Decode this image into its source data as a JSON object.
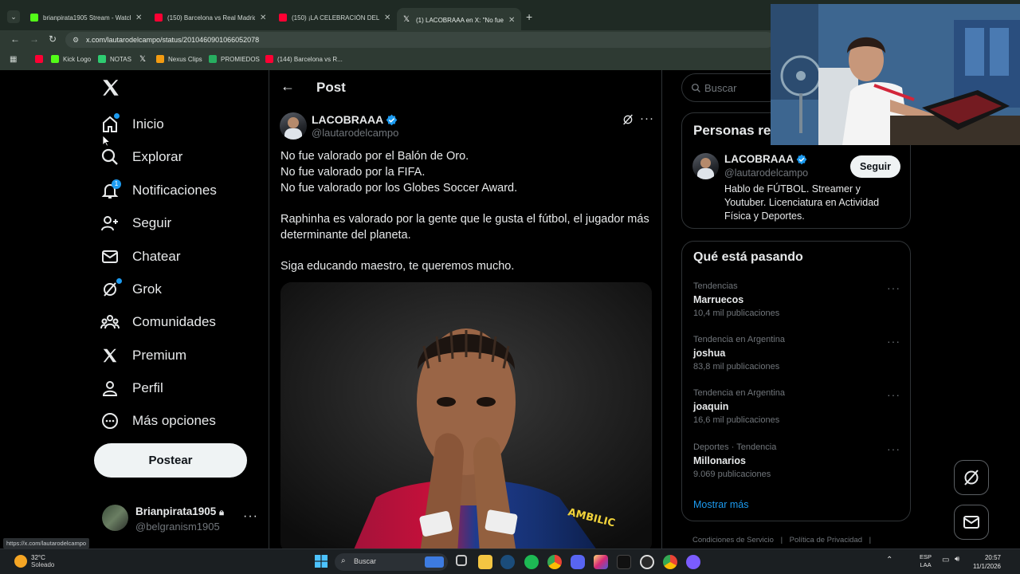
{
  "browser": {
    "tabs": [
      {
        "title": "brianpirata1905 Stream - Watch",
        "color": "#53fc18"
      },
      {
        "title": "(150) Barcelona vs Real Madrid",
        "color": "#ff0033"
      },
      {
        "title": "(150) ¡LA CELEBRACIÓN DEL TR",
        "color": "#ff0033"
      },
      {
        "title": "(1) LACOBRAAA en X: \"No fue v",
        "color": "#ffffff"
      }
    ],
    "url": "x.com/lautarodelcampo/status/2010460901066052078",
    "bookmarks": [
      {
        "label": "",
        "color": "#ff0033"
      },
      {
        "label": "Kick Logo",
        "color": "#53fc18"
      },
      {
        "label": "NOTAS",
        "color": "#2ecc71"
      },
      {
        "label": "",
        "color": "#ffffff"
      },
      {
        "label": "Nexus Clips",
        "color": "#f39c12"
      },
      {
        "label": "PROMIEDOS",
        "color": "#27ae60"
      },
      {
        "label": "(144) Barcelona vs R...",
        "color": "#ff0033"
      }
    ],
    "status_url": "https://x.com/lautarodelcampo"
  },
  "nav": {
    "items": [
      {
        "label": "Inicio",
        "icon": "home-icon"
      },
      {
        "label": "Explorar",
        "icon": "search-icon"
      },
      {
        "label": "Notificaciones",
        "icon": "bell-icon",
        "badge": "1"
      },
      {
        "label": "Seguir",
        "icon": "follow-icon"
      },
      {
        "label": "Chatear",
        "icon": "mail-icon"
      },
      {
        "label": "Grok",
        "icon": "grok-icon"
      },
      {
        "label": "Comunidades",
        "icon": "communities-icon"
      },
      {
        "label": "Premium",
        "icon": "x-logo-icon"
      },
      {
        "label": "Perfil",
        "icon": "profile-icon"
      },
      {
        "label": "Más opciones",
        "icon": "more-circle-icon"
      }
    ],
    "post_button": "Postear",
    "account": {
      "name": "Brianpirata1905",
      "handle": "@belgranism1905"
    }
  },
  "main": {
    "header": "Post",
    "author": {
      "name": "LACOBRAAA",
      "handle": "@lautarodelcampo"
    },
    "text": [
      "No fue valorado por el Balón de Oro.",
      "No fue valorado por la FIFA.",
      "No fue valorado por los Globes Soccer Award.",
      "Raphinha es valorado por la gente que le gusta el fútbol, el jugador más",
      "determinante del planeta.",
      "Siga educando maestro, te queremos mucho."
    ],
    "media_text": "AMBILIC"
  },
  "right": {
    "search_placeholder": "Buscar",
    "people_title": "Personas relevantes",
    "person": {
      "name": "LACOBRAAA",
      "handle": "@lautarodelcampo",
      "follow": "Seguir",
      "bio": [
        "Hablo de FÚTBOL. Streamer y",
        "Youtuber. Licenciatura en Actividad",
        "Física y Deportes."
      ]
    },
    "trends_title": "Qué está pasando",
    "trends": [
      {
        "meta": "Tendencias",
        "name": "Marruecos",
        "count": "10,4 mil publicaciones"
      },
      {
        "meta": "Tendencia en Argentina",
        "name": "joshua",
        "count": "83,8 mil publicaciones"
      },
      {
        "meta": "Tendencia en Argentina",
        "name": "joaquin",
        "count": "16,6 mil publicaciones"
      },
      {
        "meta": "Deportes · Tendencia",
        "name": "Millonarios",
        "count": "9.069 publicaciones"
      }
    ],
    "show_more": "Mostrar más",
    "footer": [
      "Condiciones de Servicio",
      "Política de Privacidad"
    ]
  },
  "taskbar": {
    "weather_temp": "32°C",
    "weather_desc": "Soleado",
    "search": "Buscar",
    "lang": [
      "ESP",
      "LAA"
    ],
    "time": "20:57",
    "date": "11/1/2026"
  }
}
